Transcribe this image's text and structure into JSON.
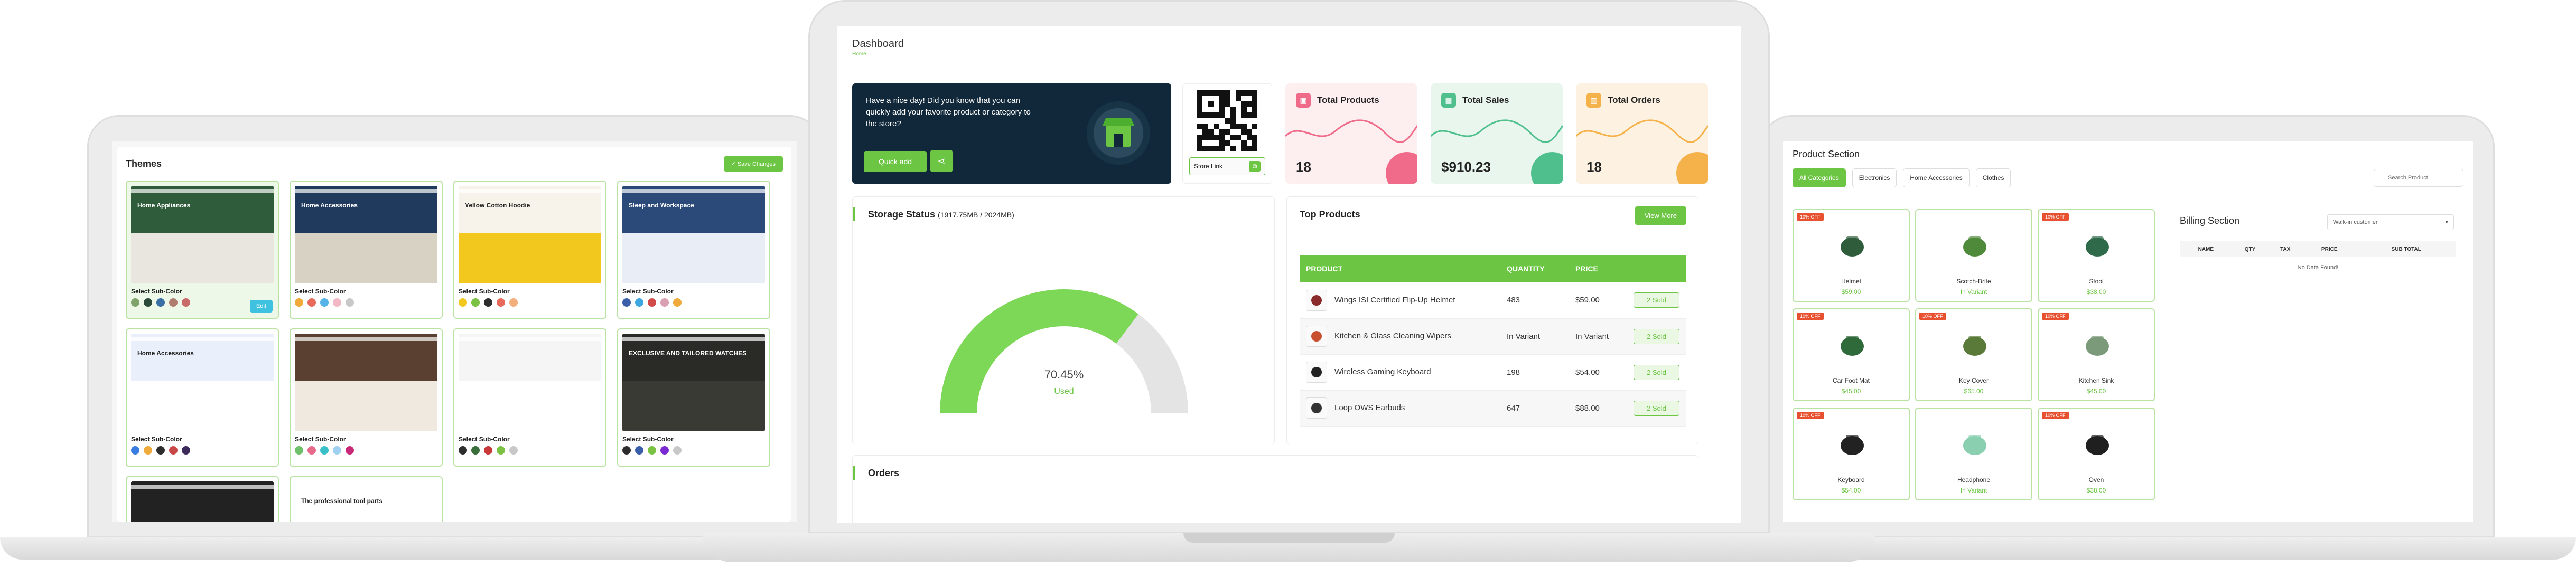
{
  "themes": {
    "title": "Themes",
    "save_label": "Save Changes",
    "sub_color_label": "Select Sub-Color",
    "edit_label": "Edit",
    "cards": [
      {
        "thumb_title": "Home Appliances",
        "selected": true,
        "top": "#2f5c3a",
        "mid": "#e9e6df",
        "swatches": [
          "#7fa36a",
          "#2d4a3b",
          "#3a6ea5",
          "#b07c6e",
          "#c86a6a"
        ]
      },
      {
        "thumb_title": "Home Accessories",
        "selected": false,
        "top": "#1f3a5c",
        "mid": "#d8d2c4",
        "swatches": [
          "#f0a93b",
          "#e86a5b",
          "#56b3e8",
          "#f2b8c6",
          "#c8c8c8"
        ]
      },
      {
        "thumb_title": "Yellow Cotton Hoodie",
        "selected": false,
        "top": "#f7f3ea",
        "mid": "#f2c81e",
        "swatches": [
          "#f2c81e",
          "#7bc143",
          "#2d2d2d",
          "#e86a5b",
          "#f4b07c"
        ]
      },
      {
        "thumb_title": "Sleep and Workspace",
        "selected": false,
        "top": "#2b4a7a",
        "mid": "#e9eef6",
        "swatches": [
          "#3a5ea8",
          "#3fa7e0",
          "#d24b4b",
          "#d8a0b0",
          "#f0a93b"
        ]
      },
      {
        "thumb_title": "Home Accessories",
        "selected": false,
        "top": "#e9f0fb",
        "mid": "#ffffff",
        "swatches": [
          "#3a7de0",
          "#f0a93b",
          "#2d2d2d",
          "#c84848",
          "#3b2a5a"
        ]
      },
      {
        "thumb_title": "",
        "selected": false,
        "top": "#5a4030",
        "mid": "#efe9df",
        "swatches": [
          "#6fc06a",
          "#e86a8a",
          "#3ac0c8",
          "#a0d0f0",
          "#c82878"
        ]
      },
      {
        "thumb_title": "",
        "selected": false,
        "top": "#f5f5f5",
        "mid": "#ffffff",
        "swatches": [
          "#2d2d2d",
          "#3a6e3a",
          "#c83838",
          "#7bc143",
          "#c8c8c8"
        ]
      },
      {
        "thumb_title": "EXCLUSIVE AND TAILORED WATCHES",
        "selected": false,
        "top": "#2a2a26",
        "mid": "#3a3a34",
        "swatches": [
          "#2d2d2d",
          "#3a5ea8",
          "#7bc143",
          "#7a2ad0",
          "#c8c8c8"
        ]
      },
      {
        "thumb_title": "",
        "selected": false,
        "top": "#222222",
        "mid": "#2a2a2a",
        "swatches": []
      },
      {
        "thumb_title": "The professional tool parts",
        "selected": false,
        "top": "#ffffff",
        "mid": "#f2f2f2",
        "swatches": []
      }
    ]
  },
  "dashboard": {
    "title": "Dashboard",
    "breadcrumb": "Home",
    "welcome_text": "Have a nice day! Did you know that you can quickly add your favorite product or category to the store?",
    "quick_add_label": "Quick add",
    "store_link_label": "Store Link",
    "stats": [
      {
        "label": "Total Products",
        "value": "18",
        "bg": "#fdeef0",
        "accent": "#f06a8a",
        "icon_bg": "#f06a8a"
      },
      {
        "label": "Total Sales",
        "value": "$910.23",
        "bg": "#e8f6ee",
        "accent": "#4fc08d",
        "icon_bg": "#4fc08d"
      },
      {
        "label": "Total Orders",
        "value": "18",
        "bg": "#fdf2e2",
        "accent": "#f5b24a",
        "icon_bg": "#f5b24a"
      }
    ],
    "storage": {
      "heading": "Storage Status",
      "detail": "(1917.75MB / 2024MB)",
      "percent": 70.45,
      "percent_label": "70.45%",
      "used_label": "Used"
    },
    "top_products": {
      "heading": "Top Products",
      "view_more_label": "View More",
      "columns": [
        "PRODUCT",
        "QUANTITY",
        "PRICE"
      ],
      "rows": [
        {
          "name": "Wings ISI Certified Flip-Up Helmet",
          "quantity": "483",
          "price": "$59.00",
          "sold": "2 Sold",
          "thumb": "#8a2a2a"
        },
        {
          "name": "Kitchen & Glass Cleaning Wipers",
          "quantity": "In Variant",
          "price": "In Variant",
          "sold": "2 Sold",
          "thumb": "#c85030"
        },
        {
          "name": "Wireless Gaming Keyboard",
          "quantity": "198",
          "price": "$54.00",
          "sold": "2 Sold",
          "thumb": "#222222"
        },
        {
          "name": "Loop OWS Earbuds",
          "quantity": "647",
          "price": "$88.00",
          "sold": "2 Sold",
          "thumb": "#333333"
        }
      ]
    },
    "orders_heading": "Orders"
  },
  "products": {
    "title": "Product Section",
    "categories": [
      "All Categories",
      "Electronics",
      "Home Accessories",
      "Clothes"
    ],
    "search_placeholder": "Search Product",
    "off_label": "10% OFF",
    "items": [
      {
        "name": "Helmet",
        "price": "$59.00",
        "off": true,
        "color": "#2f5c3a"
      },
      {
        "name": "Scotch-Brite",
        "price": "In Variant",
        "off": false,
        "color": "#4f8a3a"
      },
      {
        "name": "Stool",
        "price": "$38.00",
        "off": true,
        "color": "#2f6a4a"
      },
      {
        "name": "Car Foot Mat",
        "price": "$45.00",
        "off": true,
        "color": "#2f6a3a"
      },
      {
        "name": "Key Cover",
        "price": "$65.00",
        "off": true,
        "color": "#5a7a3a"
      },
      {
        "name": "Kitchen Sink",
        "price": "$45.00",
        "off": true,
        "color": "#7a9a7a"
      },
      {
        "name": "Keyboard",
        "price": "$54.00",
        "off": true,
        "color": "#222222"
      },
      {
        "name": "Headphone",
        "price": "In Variant",
        "off": false,
        "color": "#8ad0b0"
      },
      {
        "name": "Oven",
        "price": "$38.00",
        "off": true,
        "color": "#1f1f1f"
      }
    ],
    "billing": {
      "title": "Billing Section",
      "customer": "Walk-in customer",
      "columns": [
        "NAME",
        "QTY",
        "TAX",
        "PRICE",
        "SUB TOTAL"
      ],
      "empty_label": "No Data Found!"
    }
  }
}
